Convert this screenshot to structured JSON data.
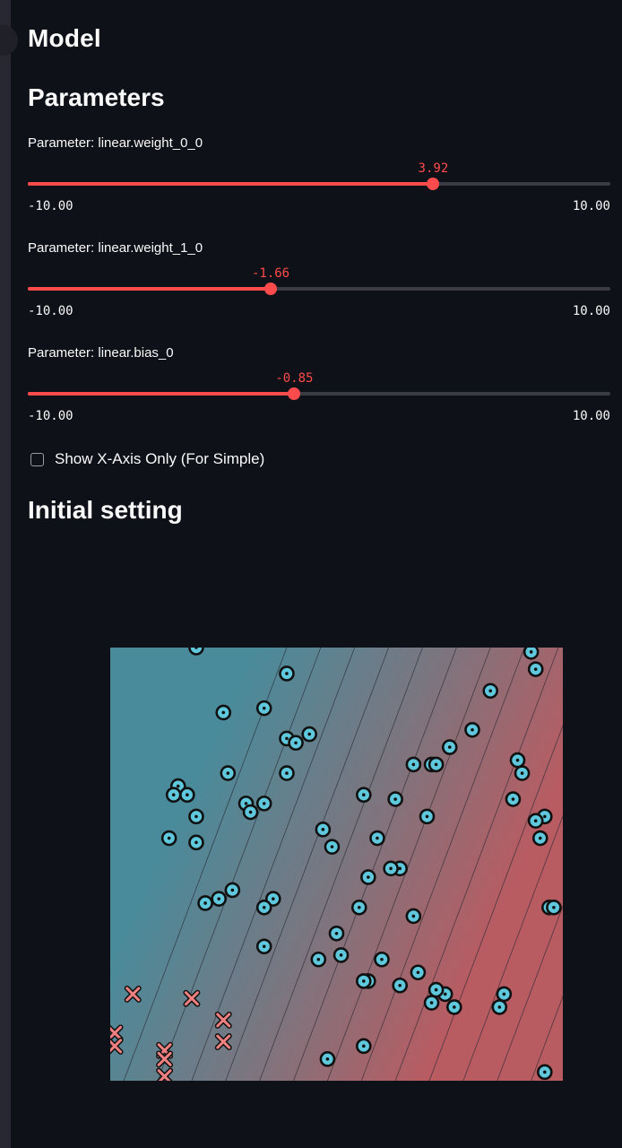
{
  "header": {
    "title": "Model"
  },
  "parameters": {
    "heading": "Parameters",
    "sliders": [
      {
        "label": "Parameter: linear.weight_0_0",
        "value": "3.92",
        "value_num": 3.92,
        "min": "-10.00",
        "max": "10.00"
      },
      {
        "label": "Parameter: linear.weight_1_0",
        "value": "-1.66",
        "value_num": -1.66,
        "min": "-10.00",
        "max": "10.00"
      },
      {
        "label": "Parameter: linear.bias_0",
        "value": "-0.85",
        "value_num": -0.85,
        "min": "-10.00",
        "max": "10.00"
      }
    ],
    "slider_range": [
      -10,
      10
    ]
  },
  "options": {
    "show_x_axis_only_label": "Show X-Axis Only (For Simple)",
    "show_x_axis_only_checked": false
  },
  "section": {
    "heading": "Initial setting"
  },
  "colors": {
    "accent": "#ff4b4b",
    "background": "#0e1117",
    "class0_fill": "#5fc8dc",
    "class1_fill": "#f08080",
    "field_left": "#4e8c9c",
    "field_right": "#b85e64"
  },
  "chart_data": {
    "type": "scatter",
    "title": "",
    "xlabel": "",
    "ylabel": "",
    "xlim": [
      0,
      1
    ],
    "ylim": [
      0,
      1
    ],
    "grid": false,
    "decision_boundary": {
      "w0": 3.92,
      "w1": -1.66,
      "b": -0.85,
      "background": "gradient-contours"
    },
    "series": [
      {
        "marker": "circle-dot",
        "x": [
          0.19,
          0.39,
          0.25,
          0.34,
          0.26,
          0.39,
          0.41,
          0.44,
          0.39,
          0.15,
          0.17,
          0.14,
          0.3,
          0.34,
          0.31,
          0.13,
          0.19,
          0.19,
          0.49,
          0.47,
          0.24,
          0.36,
          0.34,
          0.21,
          0.27,
          0.34,
          0.5,
          0.57,
          0.59,
          0.64,
          0.62,
          0.56,
          0.63,
          0.71,
          0.67,
          0.72,
          0.75,
          0.8,
          0.84,
          0.93,
          0.94,
          0.9,
          0.91,
          0.89,
          0.96,
          0.95,
          0.7,
          0.55,
          0.51,
          0.67,
          0.6,
          0.68,
          0.57,
          0.64,
          0.74,
          0.86,
          0.97,
          0.94,
          0.98,
          0.87,
          0.48,
          0.56,
          0.46,
          0.56,
          0.71,
          0.72,
          0.76,
          0.96
        ],
        "y": [
          1.0,
          0.94,
          0.85,
          0.86,
          0.71,
          0.79,
          0.78,
          0.8,
          0.71,
          0.68,
          0.66,
          0.66,
          0.64,
          0.64,
          0.62,
          0.56,
          0.55,
          0.61,
          0.54,
          0.58,
          0.42,
          0.42,
          0.4,
          0.41,
          0.44,
          0.31,
          0.34,
          0.47,
          0.56,
          0.49,
          0.49,
          0.66,
          0.65,
          0.73,
          0.73,
          0.73,
          0.77,
          0.81,
          0.9,
          0.99,
          0.95,
          0.74,
          0.71,
          0.65,
          0.61,
          0.56,
          0.61,
          0.4,
          0.29,
          0.38,
          0.28,
          0.25,
          0.23,
          0.22,
          0.2,
          0.17,
          0.4,
          0.6,
          0.4,
          0.2,
          0.05,
          0.08,
          0.28,
          0.23,
          0.18,
          0.21,
          0.17,
          0.02
        ]
      },
      {
        "marker": "x",
        "x": [
          0.05,
          0.18,
          0.25,
          0.25,
          0.01,
          0.01,
          0.12,
          0.12,
          0.12
        ],
        "y": [
          0.2,
          0.19,
          0.14,
          0.09,
          0.11,
          0.08,
          0.07,
          0.05,
          0.01
        ]
      }
    ]
  }
}
